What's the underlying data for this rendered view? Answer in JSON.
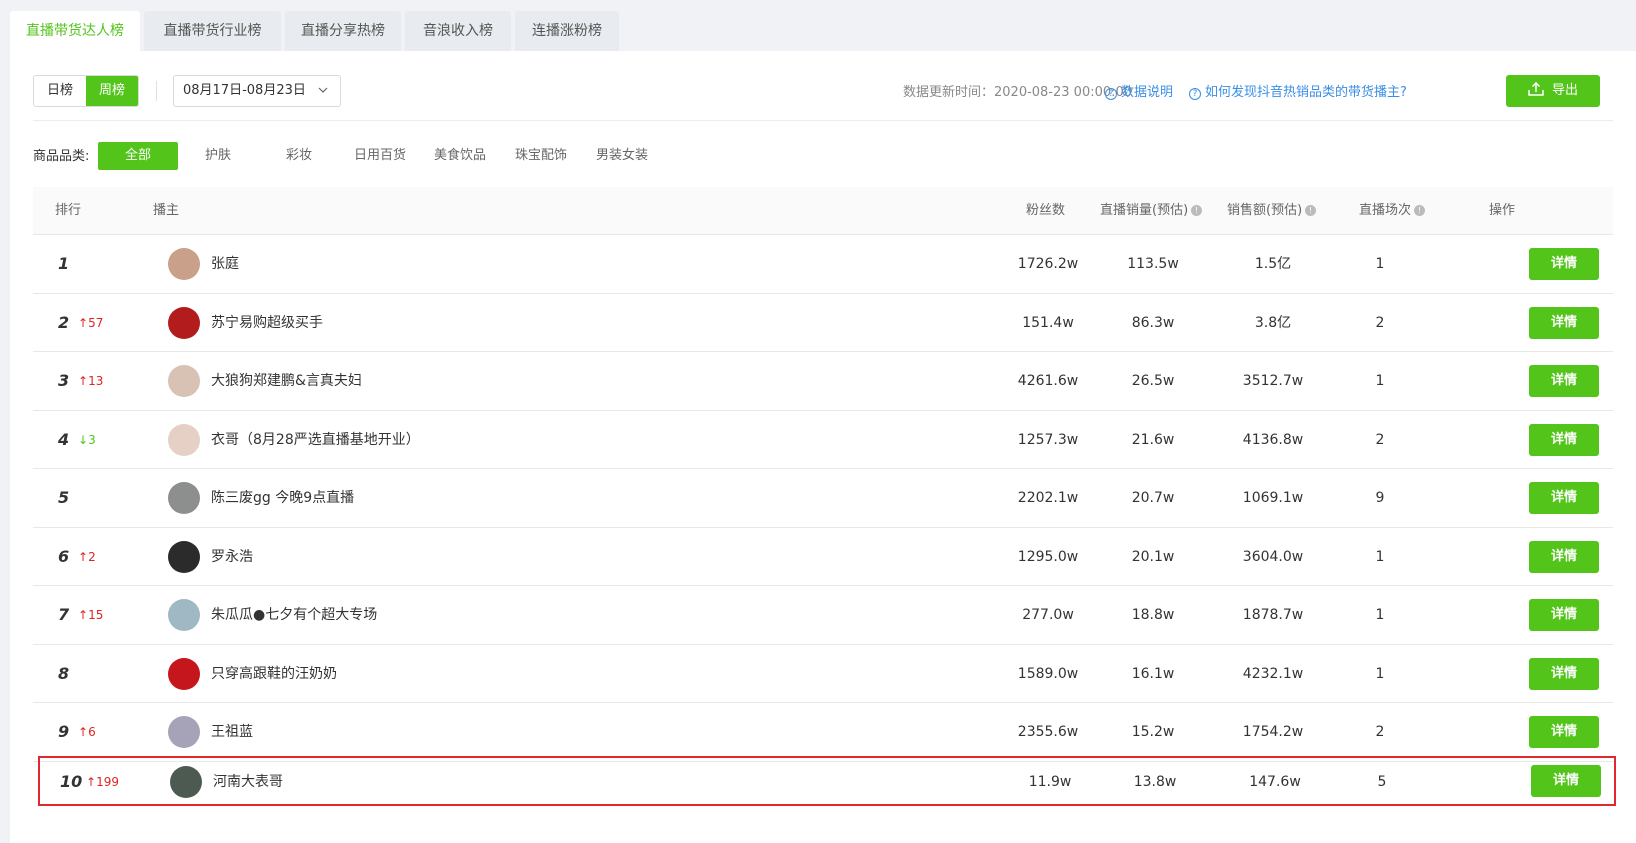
{
  "tabs": [
    {
      "label": "直播带货达人榜",
      "active": true
    },
    {
      "label": "直播带货行业榜",
      "active": false
    },
    {
      "label": "直播分享热榜",
      "active": false
    },
    {
      "label": "音浪收入榜",
      "active": false
    },
    {
      "label": "连播涨粉榜",
      "active": false
    }
  ],
  "toolbar": {
    "period_day": "日榜",
    "period_week": "周榜",
    "date_range": "08月17日-08月23日",
    "update_time": "数据更新时间：2020-08-23 00:00:00",
    "data_explain": "数据说明",
    "how_to": "如何发现抖音热销品类的带货播主?",
    "export_label": "导出"
  },
  "categories": {
    "label": "商品品类:",
    "items": [
      "全部",
      "护肤",
      "彩妆",
      "日用百货",
      "美食饮品",
      "珠宝配饰",
      "男装女装"
    ],
    "active": "全部"
  },
  "table": {
    "headers": {
      "rank": "排行",
      "host": "播主",
      "fans": "粉丝数",
      "sales": "直播销量(预估)",
      "revenue": "销售额(预估)",
      "sessions": "直播场次",
      "action": "操作"
    },
    "detail_label": "详情",
    "rows": [
      {
        "rank": "1",
        "change": "",
        "dir": "",
        "name": "张庭",
        "fans": "1726.2w",
        "sales": "113.5w",
        "revenue": "1.5亿",
        "sessions": "1",
        "avatar_color": "#c9a08a"
      },
      {
        "rank": "2",
        "change": "57",
        "dir": "up",
        "name": "苏宁易购超级买手",
        "fans": "151.4w",
        "sales": "86.3w",
        "revenue": "3.8亿",
        "sessions": "2",
        "avatar_color": "#b31c1c"
      },
      {
        "rank": "3",
        "change": "13",
        "dir": "up",
        "name": "大狼狗郑建鹏&言真夫妇",
        "fans": "4261.6w",
        "sales": "26.5w",
        "revenue": "3512.7w",
        "sessions": "1",
        "avatar_color": "#d8c2b4"
      },
      {
        "rank": "4",
        "change": "3",
        "dir": "down",
        "name": "衣哥（8月28严选直播基地开业）",
        "fans": "1257.3w",
        "sales": "21.6w",
        "revenue": "4136.8w",
        "sessions": "2",
        "avatar_color": "#e6cfc4"
      },
      {
        "rank": "5",
        "change": "",
        "dir": "",
        "name": "陈三废gg 今晚9点直播",
        "fans": "2202.1w",
        "sales": "20.7w",
        "revenue": "1069.1w",
        "sessions": "9",
        "avatar_color": "#8d8f8f"
      },
      {
        "rank": "6",
        "change": "2",
        "dir": "up",
        "name": "罗永浩",
        "fans": "1295.0w",
        "sales": "20.1w",
        "revenue": "3604.0w",
        "sessions": "1",
        "avatar_color": "#2b2b2b"
      },
      {
        "rank": "7",
        "change": "15",
        "dir": "up",
        "name": "朱瓜瓜●七夕有个超大专场",
        "fans": "277.0w",
        "sales": "18.8w",
        "revenue": "1878.7w",
        "sessions": "1",
        "avatar_color": "#9fb8c4"
      },
      {
        "rank": "8",
        "change": "",
        "dir": "",
        "name": "只穿高跟鞋的汪奶奶",
        "fans": "1589.0w",
        "sales": "16.1w",
        "revenue": "4232.1w",
        "sessions": "1",
        "avatar_color": "#c4161c"
      },
      {
        "rank": "9",
        "change": "6",
        "dir": "up",
        "name": "王祖蓝",
        "fans": "2355.6w",
        "sales": "15.2w",
        "revenue": "1754.2w",
        "sessions": "2",
        "avatar_color": "#a6a3b8"
      },
      {
        "rank": "10",
        "change": "199",
        "dir": "up",
        "name": "河南大表哥",
        "fans": "11.9w",
        "sales": "13.8w",
        "revenue": "147.6w",
        "sessions": "5",
        "avatar_color": "#4d5a52",
        "highlight": true
      }
    ]
  }
}
